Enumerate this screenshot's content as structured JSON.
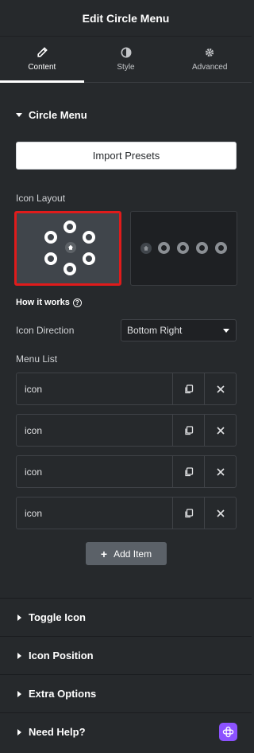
{
  "header": {
    "title": "Edit Circle Menu"
  },
  "tabs": [
    {
      "label": "Content",
      "icon": "pencil-icon",
      "active": true
    },
    {
      "label": "Style",
      "icon": "half-circle-icon",
      "active": false
    },
    {
      "label": "Advanced",
      "icon": "gear-icon",
      "active": false
    }
  ],
  "circle_menu": {
    "title": "Circle Menu",
    "import_label": "Import Presets",
    "icon_layout_label": "Icon Layout",
    "how_it_works": "How it works",
    "icon_direction_label": "Icon Direction",
    "icon_direction_value": "Bottom Right",
    "menu_list_label": "Menu List",
    "items": [
      {
        "label": "icon"
      },
      {
        "label": "icon"
      },
      {
        "label": "icon"
      },
      {
        "label": "icon"
      }
    ],
    "add_item_label": "Add Item"
  },
  "sections": [
    {
      "title": "Toggle Icon"
    },
    {
      "title": "Icon Position"
    },
    {
      "title": "Extra Options"
    },
    {
      "title": "Need Help?"
    }
  ],
  "colors": {
    "background": "#26292c",
    "selected_border": "#e01b1b",
    "help_badge": "#8c52ff"
  }
}
